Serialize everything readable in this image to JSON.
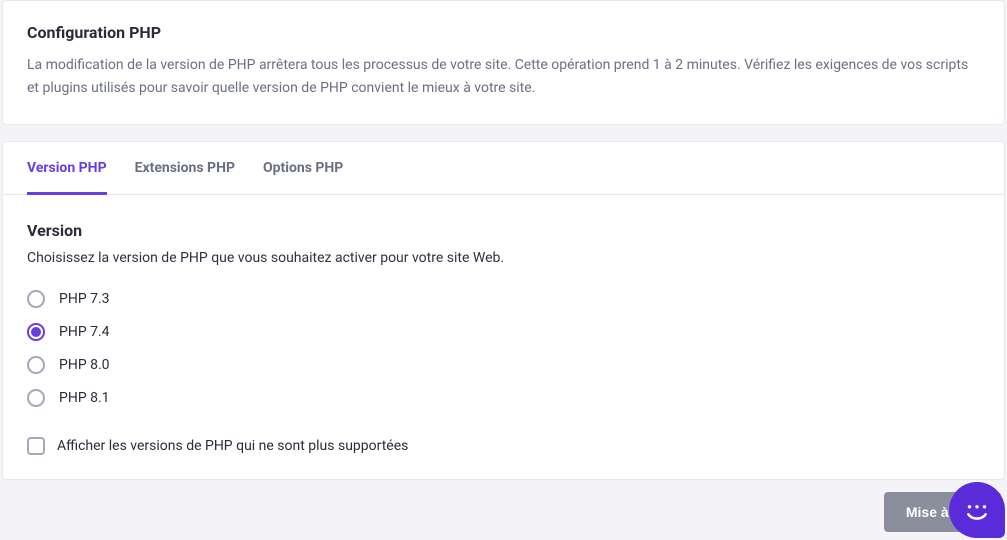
{
  "header": {
    "title": "Configuration PHP",
    "description": "La modification de la version de PHP arrêtera tous les processus de votre site. Cette opération prend 1 à 2 minutes. Vérifiez les exigences de vos scripts et plugins utilisés pour savoir quelle version de PHP convient le mieux à votre site."
  },
  "tabs": [
    {
      "label": "Version PHP",
      "active": true
    },
    {
      "label": "Extensions PHP",
      "active": false
    },
    {
      "label": "Options PHP",
      "active": false
    }
  ],
  "section": {
    "title": "Version",
    "description": "Choisissez la version de PHP que vous souhaitez activer pour votre site Web."
  },
  "versions": [
    {
      "label": "PHP 7.3",
      "selected": false
    },
    {
      "label": "PHP 7.4",
      "selected": true
    },
    {
      "label": "PHP 8.0",
      "selected": false
    },
    {
      "label": "PHP 8.1",
      "selected": false
    }
  ],
  "checkbox": {
    "label": "Afficher les versions de PHP qui ne sont plus supportées",
    "checked": false
  },
  "update_button": "Mise à jour",
  "colors": {
    "accent": "#673de6",
    "chat": "#5a2bd9",
    "muted": "#6b6f84"
  }
}
